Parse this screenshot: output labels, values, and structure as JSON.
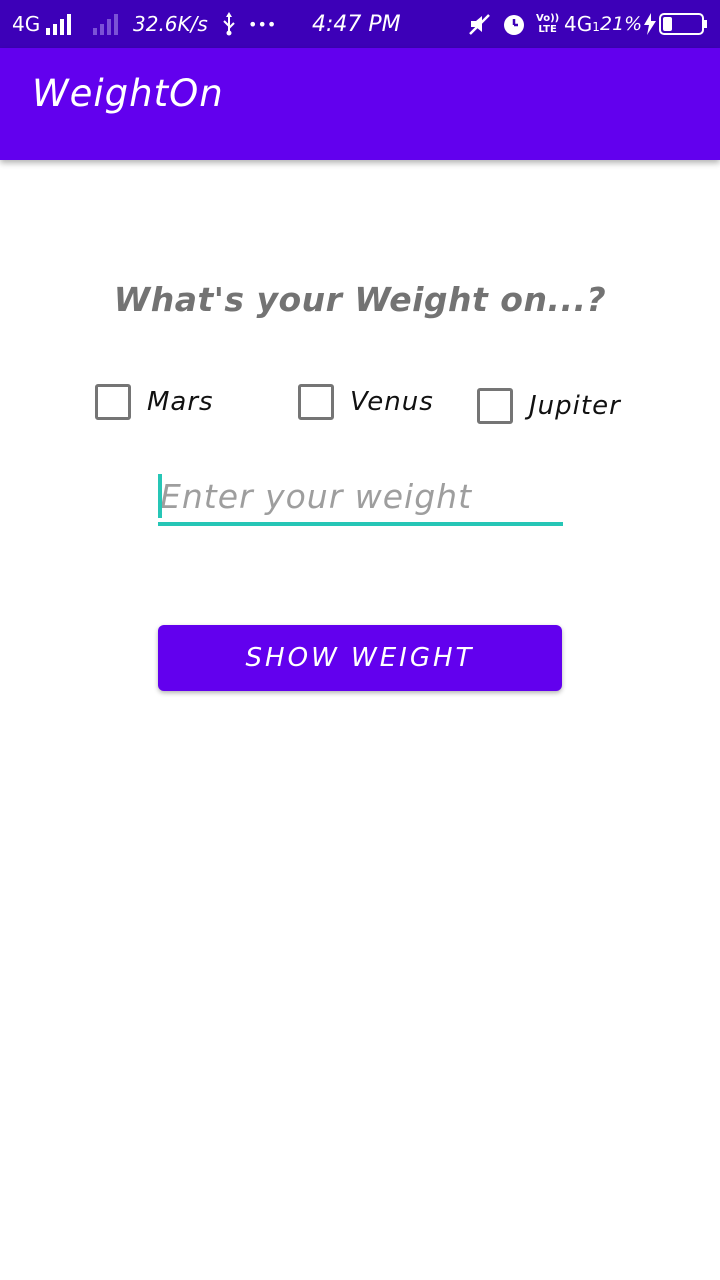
{
  "status_bar": {
    "network_left": "4G",
    "speed": "32.6K/s",
    "dots": "•••",
    "time": "4:47 PM",
    "volte_top": "Vo))",
    "volte_bottom": "LTE",
    "network_right": "4G",
    "network_right_sub": "1",
    "battery": "21%"
  },
  "app_bar": {
    "title": "WeightOn"
  },
  "main": {
    "question": "What's your Weight on...?",
    "checkboxes": [
      {
        "label": "Mars",
        "checked": false
      },
      {
        "label": "Venus",
        "checked": false
      },
      {
        "label": "Jupiter",
        "checked": false
      }
    ],
    "weight_input": {
      "placeholder": "Enter your weight",
      "value": ""
    },
    "show_button_label": "SHOW WEIGHT"
  },
  "colors": {
    "status_bar": "#3d00b8",
    "primary": "#6200ee",
    "accent": "#26c6b6",
    "checkbox_border": "#757575",
    "question_text": "#737373"
  }
}
